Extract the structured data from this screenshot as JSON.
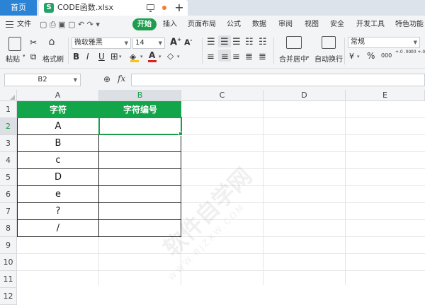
{
  "titlebar": {
    "home_tab": "首页",
    "file_icon": "S",
    "file_name": "CODE函数.xlsx",
    "new_tab": "+"
  },
  "menubar": {
    "file": "文件",
    "start": "开始",
    "items": [
      "插入",
      "页面布局",
      "公式",
      "数据",
      "审阅",
      "视图",
      "安全",
      "开发工具",
      "特色功能"
    ]
  },
  "ribbon": {
    "paste": "粘贴",
    "format_painter": "格式刷",
    "font_name": "微软雅黑",
    "font_size": "14",
    "merge": "合并居中",
    "wrap": "自动换行",
    "number_format": "常规",
    "bold": "B",
    "italic": "I",
    "underline": "U",
    "font_color": "A",
    "percent": "%",
    "thousands": "000",
    "inc_decimal": "+.0 .00",
    "dec_decimal": ".00 +.0"
  },
  "formulabar": {
    "cell_ref": "B2",
    "fx_label": "fx",
    "value": ""
  },
  "sheet": {
    "columns": [
      "A",
      "B",
      "C",
      "D",
      "E"
    ],
    "rows": [
      "1",
      "2",
      "3",
      "4",
      "5",
      "6",
      "7",
      "8",
      "9",
      "10",
      "11",
      "12"
    ],
    "header_a": "字符",
    "header_b": "字符编号",
    "values": [
      "A",
      "B",
      "c",
      "D",
      "e",
      "?",
      "/"
    ],
    "selected_cell": "B2",
    "accent_color": "#12a54a"
  },
  "watermark": {
    "main": "软件自学网",
    "url": "WWW.RJZXW.COM"
  }
}
